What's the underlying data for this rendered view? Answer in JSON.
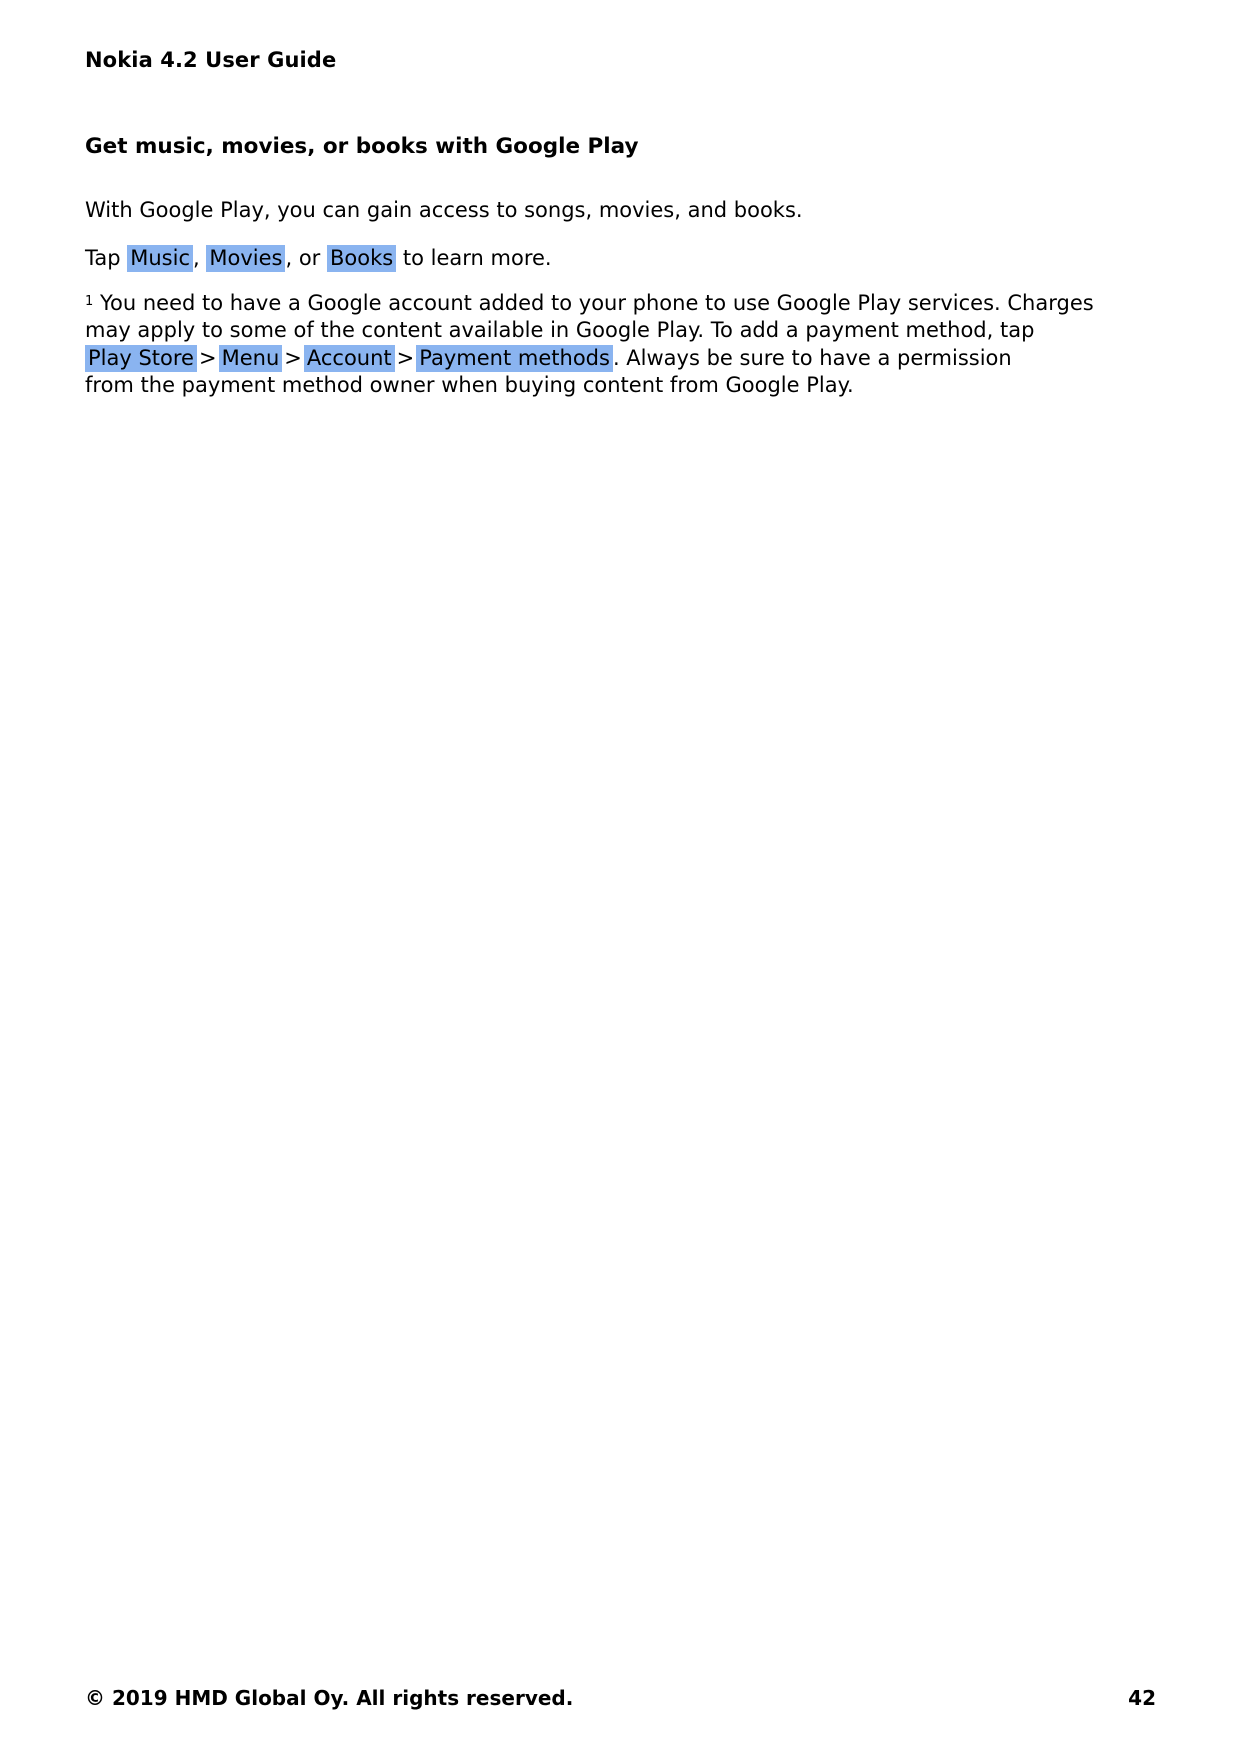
{
  "document": {
    "header_title": "Nokia 4.2 User Guide",
    "section_heading": "Get music, movies, or books with Google Play",
    "intro_paragraph": "With Google Play, you can gain access to songs, movies, and books.",
    "tap_line": {
      "prefix": "Tap",
      "item1": "Music",
      "comma1": ",",
      "item2": "Movies",
      "comma2": ", or",
      "item3": "Books",
      "suffix": "to learn more."
    },
    "footnote": {
      "marker": "1",
      "line1_text": "You need to have a Google account added to your phone to use Google Play services.  Charges",
      "line2_text": "may apply to some of the content available in Google Play.  To add a payment method, tap",
      "breadcrumb": {
        "step1": "Play Store",
        "sep1": ">",
        "step2": "Menu",
        "sep2": ">",
        "step3": "Account",
        "sep3": ">",
        "step4": "Payment methods",
        "trailing_text": ". Always be sure to have a permission"
      },
      "line4_text": "from the payment method owner when buying content from Google Play."
    },
    "footer": {
      "copyright": "© 2019 HMD Global Oy. All rights reserved.",
      "page_number": "42"
    },
    "colors": {
      "highlight": "#8ab4f0",
      "text": "#000000",
      "background": "#ffffff"
    }
  }
}
